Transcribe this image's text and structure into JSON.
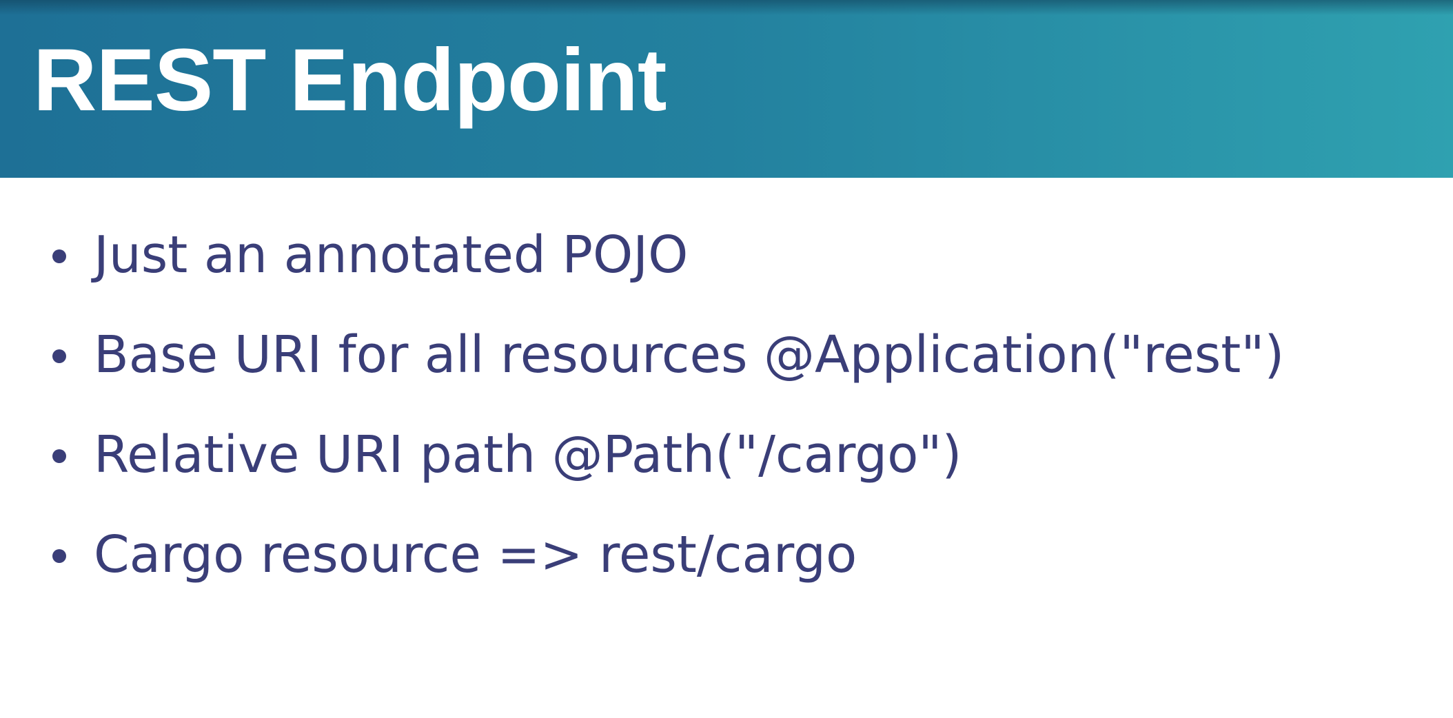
{
  "slide": {
    "title": "REST Endpoint",
    "bullets": [
      "Just an annotated POJO",
      "Base URI for all resources @Application(\"rest\")",
      "Relative URI path @Path(\"/cargo\")",
      "Cargo resource => rest/cargo"
    ]
  },
  "colors": {
    "title_bar": "#23819f",
    "title_text": "#ffffff",
    "body_text": "#3a3e78",
    "background": "#ffffff"
  }
}
